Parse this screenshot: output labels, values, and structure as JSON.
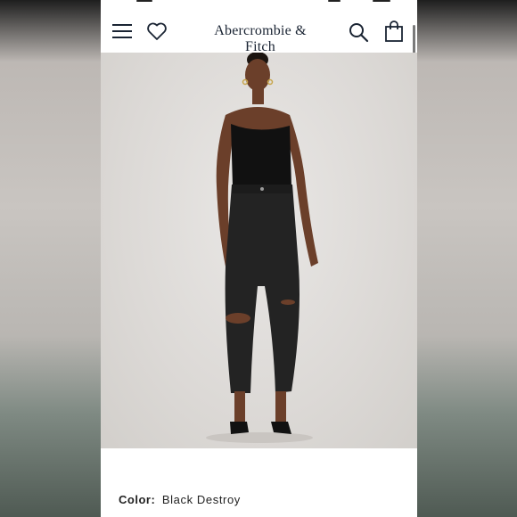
{
  "header": {
    "brand": "Abercrombie & Fitch",
    "icons": {
      "menu": "hamburger-menu-icon",
      "wishlist": "heart-icon",
      "search": "search-icon",
      "bag": "shopping-bag-icon"
    }
  },
  "product": {
    "image_alt": "Model wearing black strapless top and black distressed high-rise jeans",
    "color_label": "Color:",
    "color_value": "Black Destroy"
  },
  "colors": {
    "brand_text": "#1a2433",
    "top": "#111111",
    "denim": "#232323",
    "skin": "#6b3f2a",
    "background": "#dcd9d6"
  }
}
